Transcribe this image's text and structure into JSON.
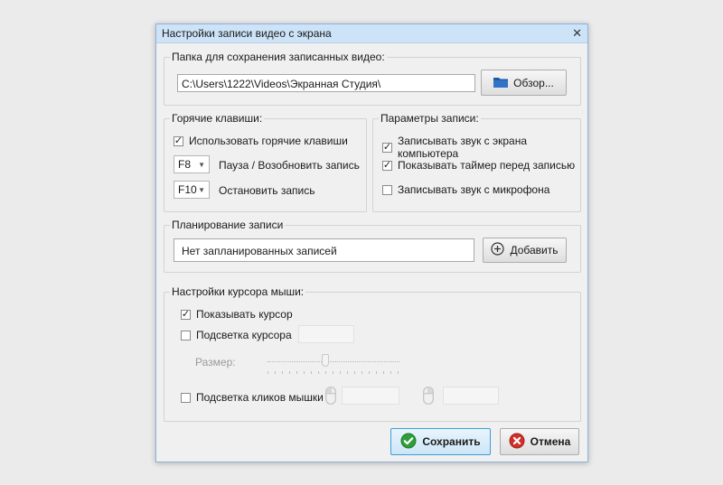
{
  "window": {
    "title": "Настройки записи видео с экрана",
    "close_glyph": "✕"
  },
  "folder": {
    "legend": "Папка для сохранения записанных видео:",
    "path": "C:\\Users\\1222\\Videos\\Экранная Студия\\",
    "browse_label": "Обзор..."
  },
  "hotkeys": {
    "legend": "Горячие клавиши:",
    "use_hotkeys_label": "Использовать горячие клавиши",
    "use_hotkeys_checked": true,
    "pause_key": "F8",
    "pause_label": "Пауза / Возобновить запись",
    "stop_key": "F10",
    "stop_label": "Остановить запись"
  },
  "record_params": {
    "legend": "Параметры записи:",
    "options": [
      {
        "label": "Записывать звук с экрана компьютера",
        "checked": true
      },
      {
        "label": "Показывать таймер перед записью",
        "checked": true
      },
      {
        "label": "Записывать звук с микрофона",
        "checked": false
      }
    ]
  },
  "schedule": {
    "legend": "Планирование записи",
    "status": "Нет запланированных записей",
    "add_label": "Добавить"
  },
  "cursor": {
    "legend": "Настройки курсора мыши:",
    "show_cursor_label": "Показывать курсор",
    "show_cursor_checked": true,
    "highlight_label": "Подсветка курсора",
    "highlight_checked": false,
    "size_label": "Размер:",
    "size_level": 0.4,
    "click_highlight_label": "Подсветка кликов мышки",
    "click_highlight_checked": false
  },
  "footer": {
    "save_label": "Сохранить",
    "cancel_label": "Отмена"
  },
  "colors": {
    "title_bar": "#cde3f7",
    "save_border": "#3c9fd8",
    "save_check": "#2e9e3a",
    "cancel_x": "#d0302b",
    "folder_icon": "#1f5aa8"
  },
  "icons": {
    "browse": "folder-icon",
    "add": "plus-circle-icon",
    "save": "check-circle-icon",
    "cancel": "x-circle-icon",
    "mouse": "mouse-icon"
  }
}
